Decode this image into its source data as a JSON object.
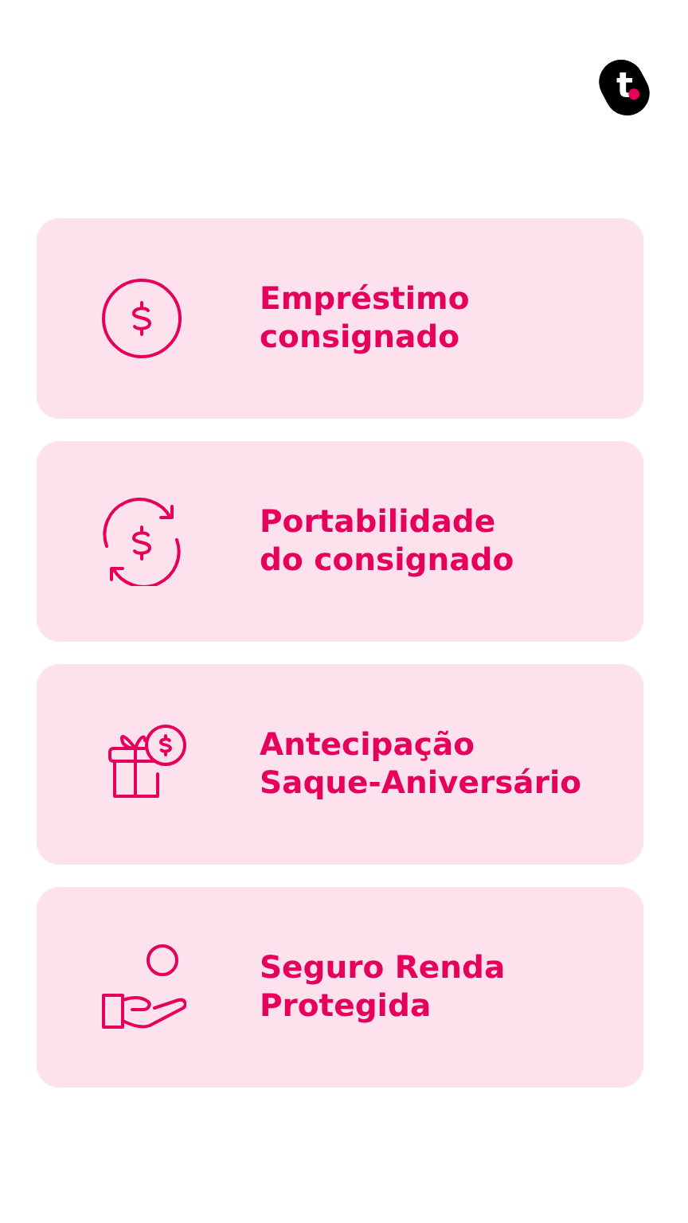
{
  "logo": {
    "text": "t"
  },
  "options": [
    {
      "kind": "coin",
      "lines": [
        "Empréstimo",
        "consignado"
      ]
    },
    {
      "kind": "exchange",
      "lines": [
        "Portabilidade",
        "do consignado"
      ]
    },
    {
      "kind": "gift",
      "lines": [
        "Antecipação",
        "Saque-Aniversário"
      ]
    },
    {
      "kind": "hand",
      "lines": [
        "Seguro Renda",
        "Protegida"
      ]
    }
  ]
}
